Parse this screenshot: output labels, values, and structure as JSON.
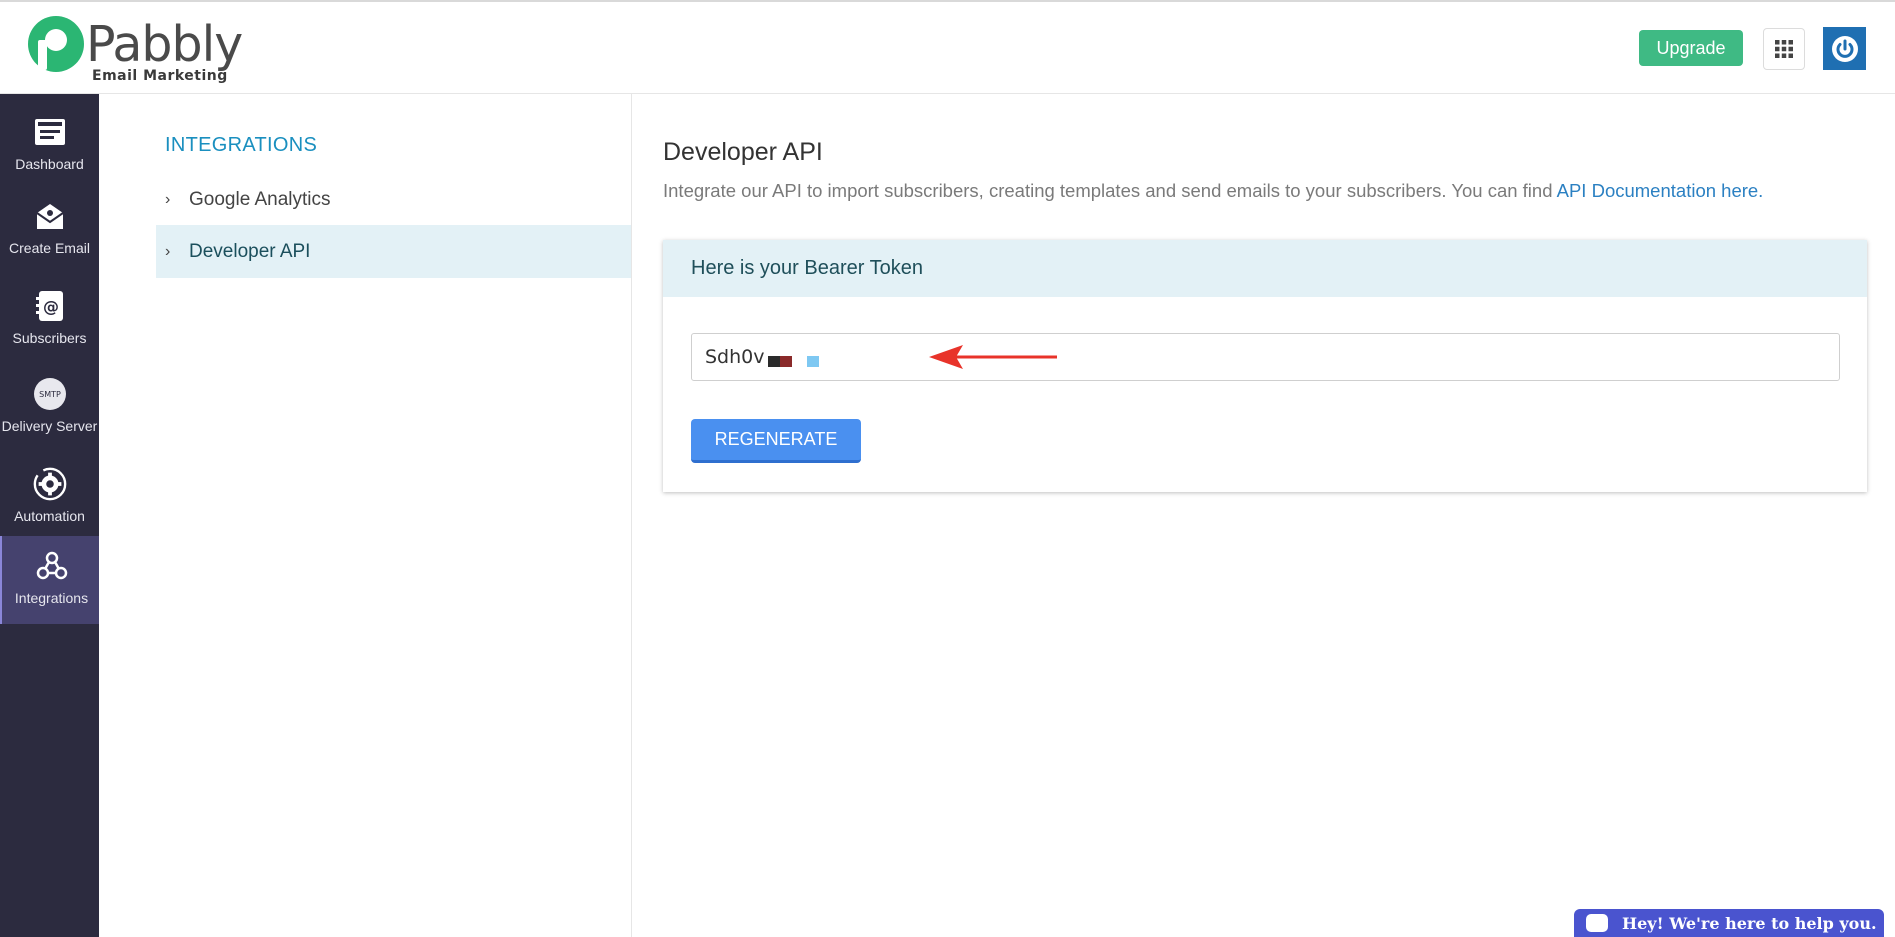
{
  "header": {
    "logo_text": "Pabbly",
    "logo_sub": "Email Marketing",
    "upgrade_label": "Upgrade"
  },
  "sidebar": {
    "items": [
      {
        "label": "Dashboard",
        "icon": "dashboard-icon"
      },
      {
        "label": "Create Email",
        "icon": "create-email-icon"
      },
      {
        "label": "Subscribers",
        "icon": "subscribers-icon"
      },
      {
        "label": "Delivery Server",
        "icon": "smtp-icon",
        "icon_text": "SMTP"
      },
      {
        "label": "Automation",
        "icon": "automation-icon"
      },
      {
        "label": "Integrations",
        "icon": "integrations-icon",
        "active": true
      }
    ]
  },
  "subnav": {
    "title": "INTEGRATIONS",
    "items": [
      {
        "label": "Google Analytics"
      },
      {
        "label": "Developer API",
        "active": true
      }
    ]
  },
  "main": {
    "title": "Developer API",
    "description": "Integrate our API to import subscribers, creating templates and send emails to your subscribers. You can find ",
    "doc_link": "API Documentation here.",
    "card": {
      "heading": "Here is your Bearer Token",
      "token_value": "Sdh0v",
      "regenerate_label": "REGENERATE"
    }
  },
  "chat": {
    "label": "Hey! We're here to help you."
  },
  "colors": {
    "brand_green": "#2bb673",
    "sidebar_bg": "#2c2b3f",
    "sidebar_active": "#45426e",
    "accent_blue": "#1a8fbf",
    "button_blue": "#4a90f0",
    "annotation_red": "#e8332a"
  }
}
